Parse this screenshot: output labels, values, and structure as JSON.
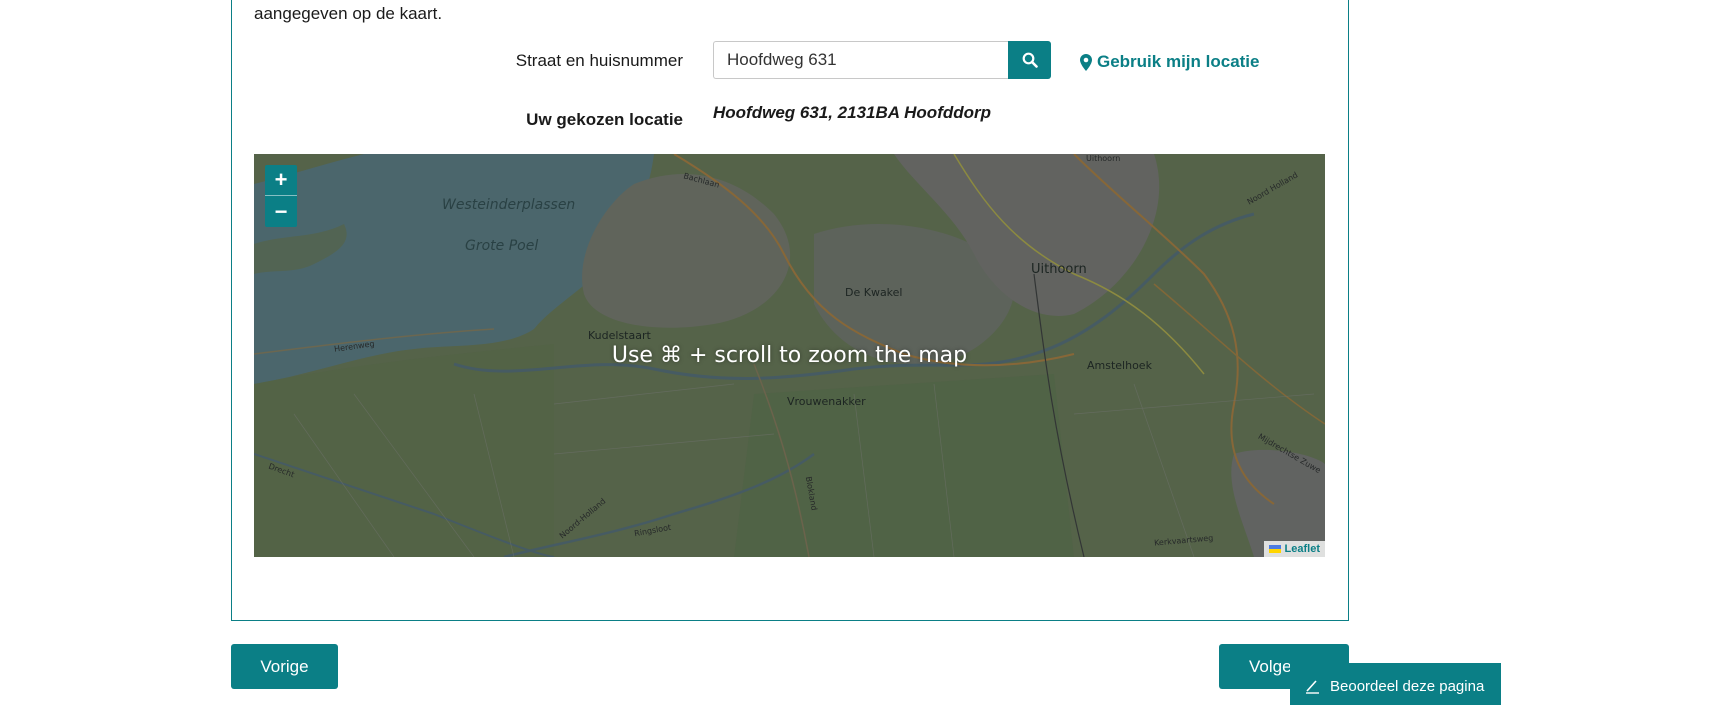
{
  "intro_text": "aangegeven op de kaart.",
  "address": {
    "street_label": "Straat en huisnummer",
    "street_value": "Hoofdweg 631",
    "search_icon": "search-icon",
    "locate_label": "Gebruik mijn locatie",
    "locate_icon": "map-marker-icon",
    "chosen_label": "Uw gekozen locatie",
    "chosen_value": "Hoofdweg 631, 2131BA Hoofddorp"
  },
  "map": {
    "overlay_text": "Use ⌘ + scroll to zoom the map",
    "zoom_in": "+",
    "zoom_out": "−",
    "attribution": "Leaflet",
    "places": {
      "westeinderplassen": "Westeinderplassen",
      "grote_poel": "Grote Poel",
      "uithoorn": "Uithoorn",
      "de_kwakel": "De Kwakel",
      "kudelstaart": "Kudelstaart",
      "vrouwenakker": "Vrouwenakker",
      "amstelhoek": "Amstelhoek",
      "bachlaan": "Bachlaan",
      "uithoorn_small": "Uithoorn",
      "noord_holland_top": "Noord Holland",
      "herenweg": "Herenweg",
      "drecht": "Drecht",
      "noord_holland_bottom": "Noord-Holland",
      "ringsloot": "Ringsloot",
      "blokland": "Blokland",
      "mijdrechtse_zuwe": "Mijdrechtse Zuwe",
      "kerkvaartsweg": "Kerkvaartsweg"
    }
  },
  "nav": {
    "prev_label": "Vorige",
    "next_label": "Volge",
    "feedback_label": "Beoordeel deze pagina",
    "feedback_icon": "pencil-icon"
  },
  "colors": {
    "accent": "#0b7f86"
  }
}
